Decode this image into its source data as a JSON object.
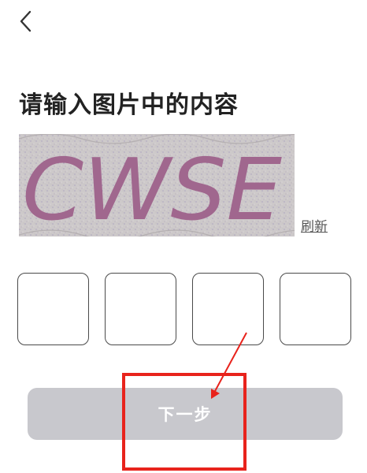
{
  "header": {
    "back_icon": "chevron-left-icon"
  },
  "page": {
    "title": "请输入图片中的内容"
  },
  "captcha": {
    "text": "CWSE",
    "background_color": "#cdc9ca",
    "text_color": "#a0678e"
  },
  "refresh": {
    "label": "刷新"
  },
  "code_inputs": [
    {
      "value": ""
    },
    {
      "value": ""
    },
    {
      "value": ""
    },
    {
      "value": ""
    }
  ],
  "next_button": {
    "label": "下一步",
    "background_color": "#c8c8cd"
  },
  "annotation": {
    "color": "#e8231c"
  }
}
